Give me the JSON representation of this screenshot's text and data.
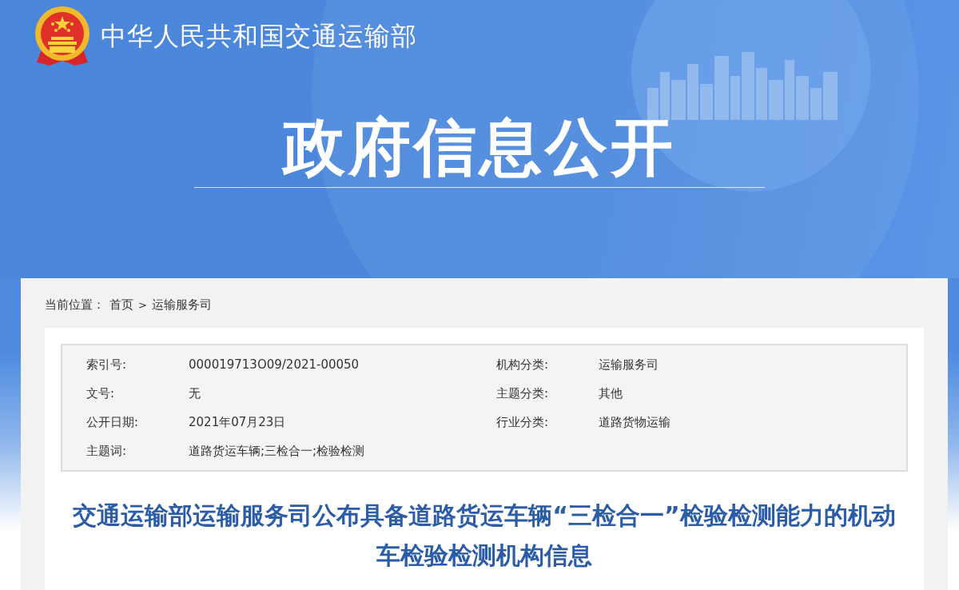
{
  "header": {
    "site_name": "中华人民共和国交通运输部",
    "banner_title": "政府信息公开"
  },
  "breadcrumb": {
    "label": "当前位置：",
    "items": [
      {
        "text": "首页"
      },
      {
        "text": "运输服务司"
      }
    ],
    "separator": ">"
  },
  "meta": [
    {
      "label": "索引号:",
      "value": "000019713O09/2021-00050"
    },
    {
      "label": "机构分类:",
      "value": "运输服务司"
    },
    {
      "label": "文号:",
      "value": "无"
    },
    {
      "label": "主题分类:",
      "value": "其他"
    },
    {
      "label": "公开日期:",
      "value": "2021年07月23日"
    },
    {
      "label": "行业分类:",
      "value": "道路货物运输"
    },
    {
      "label": "主题词:",
      "value": "道路货运车辆;三检合一;检验检测"
    }
  ],
  "article": {
    "title": "交通运输部运输服务司公布具备道路货运车辆“三检合一”检验检测能力的机动车检验检测机构信息"
  }
}
